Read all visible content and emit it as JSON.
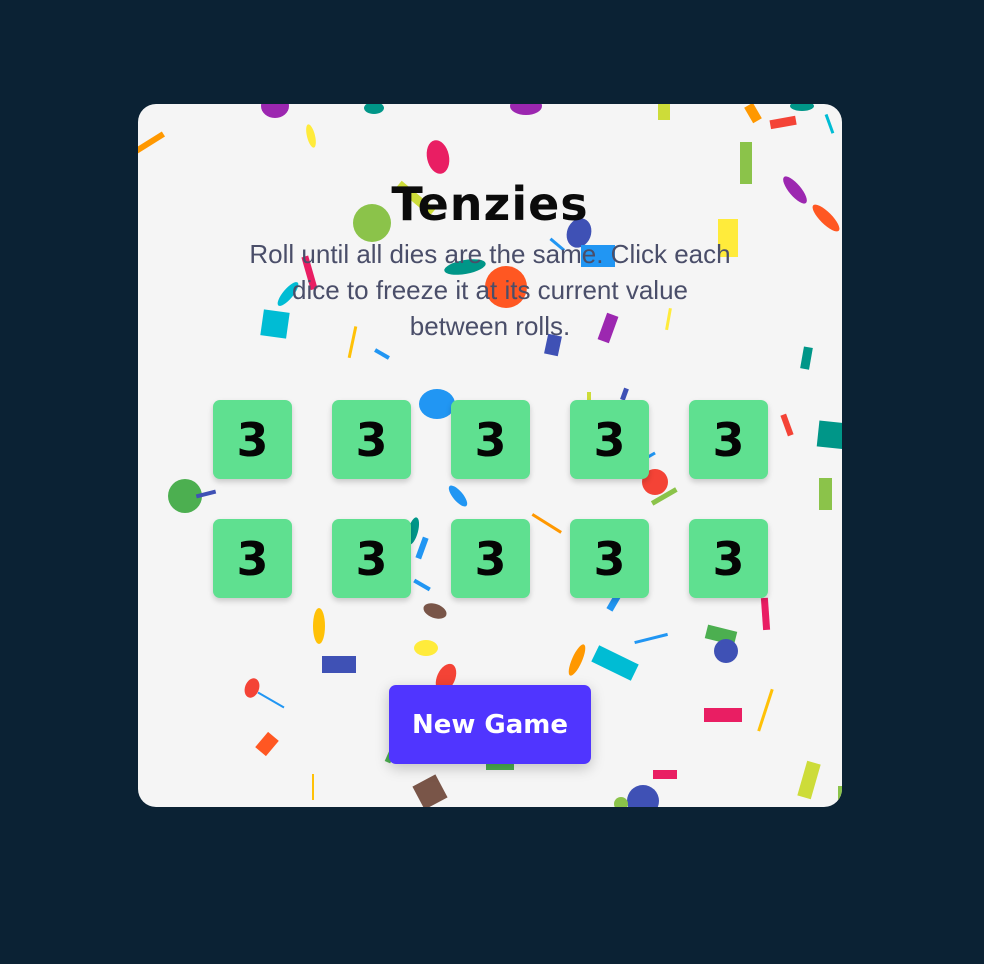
{
  "game": {
    "title": "Tenzies",
    "instructions": "Roll until all dies are the same. Click each dice to freeze it at its current value between rolls.",
    "dice": [
      {
        "value": "3",
        "held": false
      },
      {
        "value": "3",
        "held": false
      },
      {
        "value": "3",
        "held": false
      },
      {
        "value": "3",
        "held": false
      },
      {
        "value": "3",
        "held": false
      },
      {
        "value": "3",
        "held": false
      },
      {
        "value": "3",
        "held": false
      },
      {
        "value": "3",
        "held": false
      },
      {
        "value": "3",
        "held": false
      },
      {
        "value": "3",
        "held": false
      }
    ],
    "button_label": "New Game"
  },
  "colors": {
    "page_background": "#0b2234",
    "card_background": "#f5f5f5",
    "die": "#5fe090",
    "button": "#5035ff",
    "confetti": [
      "#e91e63",
      "#9c27b0",
      "#3f51b5",
      "#2196f3",
      "#00bcd4",
      "#009688",
      "#4caf50",
      "#8bc34a",
      "#cddc39",
      "#ffeb3b",
      "#ffc107",
      "#ff9800",
      "#ff5722",
      "#795548",
      "#f44336"
    ]
  }
}
